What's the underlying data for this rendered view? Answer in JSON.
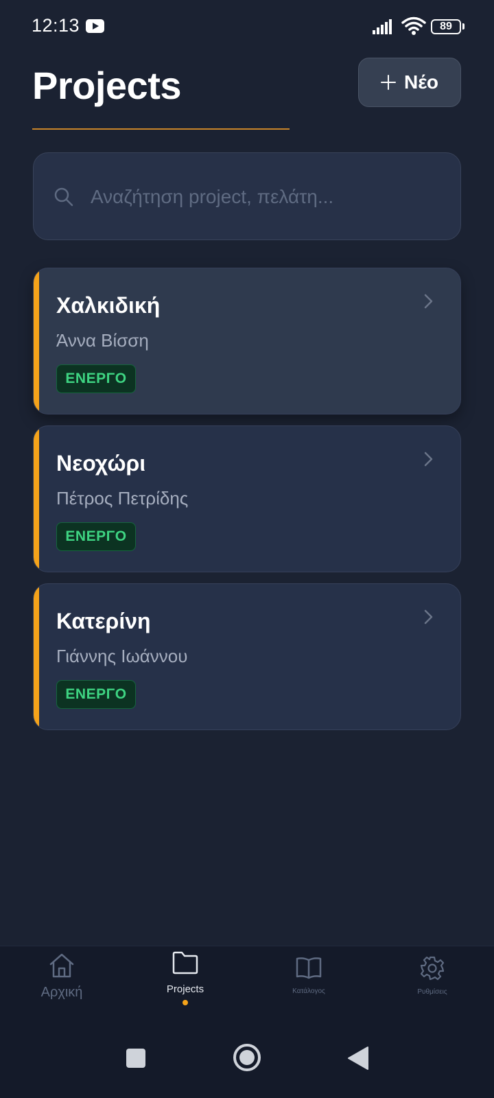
{
  "status_bar": {
    "time": "12:13",
    "battery": "89",
    "icons": [
      "youtube-icon",
      "signal-icon",
      "wifi-icon",
      "battery-icon"
    ]
  },
  "header": {
    "title": "Projects",
    "new_button_label": "Νέο"
  },
  "search": {
    "placeholder": "Αναζήτηση project, πελάτη...",
    "value": ""
  },
  "projects": [
    {
      "title": "Χαλκιδική",
      "client": "Άννα Βίσση",
      "status": "ΕΝΕΡΓΟ"
    },
    {
      "title": "Νεοχώρι",
      "client": "Πέτρος Πετρίδης",
      "status": "ΕΝΕΡΓΟ"
    },
    {
      "title": "Κατερίνη",
      "client": "Γιάννης Ιωάννου",
      "status": "ΕΝΕΡΓΟ"
    }
  ],
  "bottom_nav": {
    "items": [
      {
        "label": "Αρχική",
        "icon": "home-icon",
        "active": false
      },
      {
        "label": "Projects",
        "icon": "folder-icon",
        "active": true
      },
      {
        "label": "Κατάλογος",
        "icon": "book-icon",
        "active": false
      },
      {
        "label": "Ρυθμίσεις",
        "icon": "gear-icon",
        "active": false
      }
    ]
  },
  "colors": {
    "background": "#1b2232",
    "accent": "#f5a31a",
    "status_active_text": "#3ed482",
    "status_active_bg": "#0c3322"
  }
}
